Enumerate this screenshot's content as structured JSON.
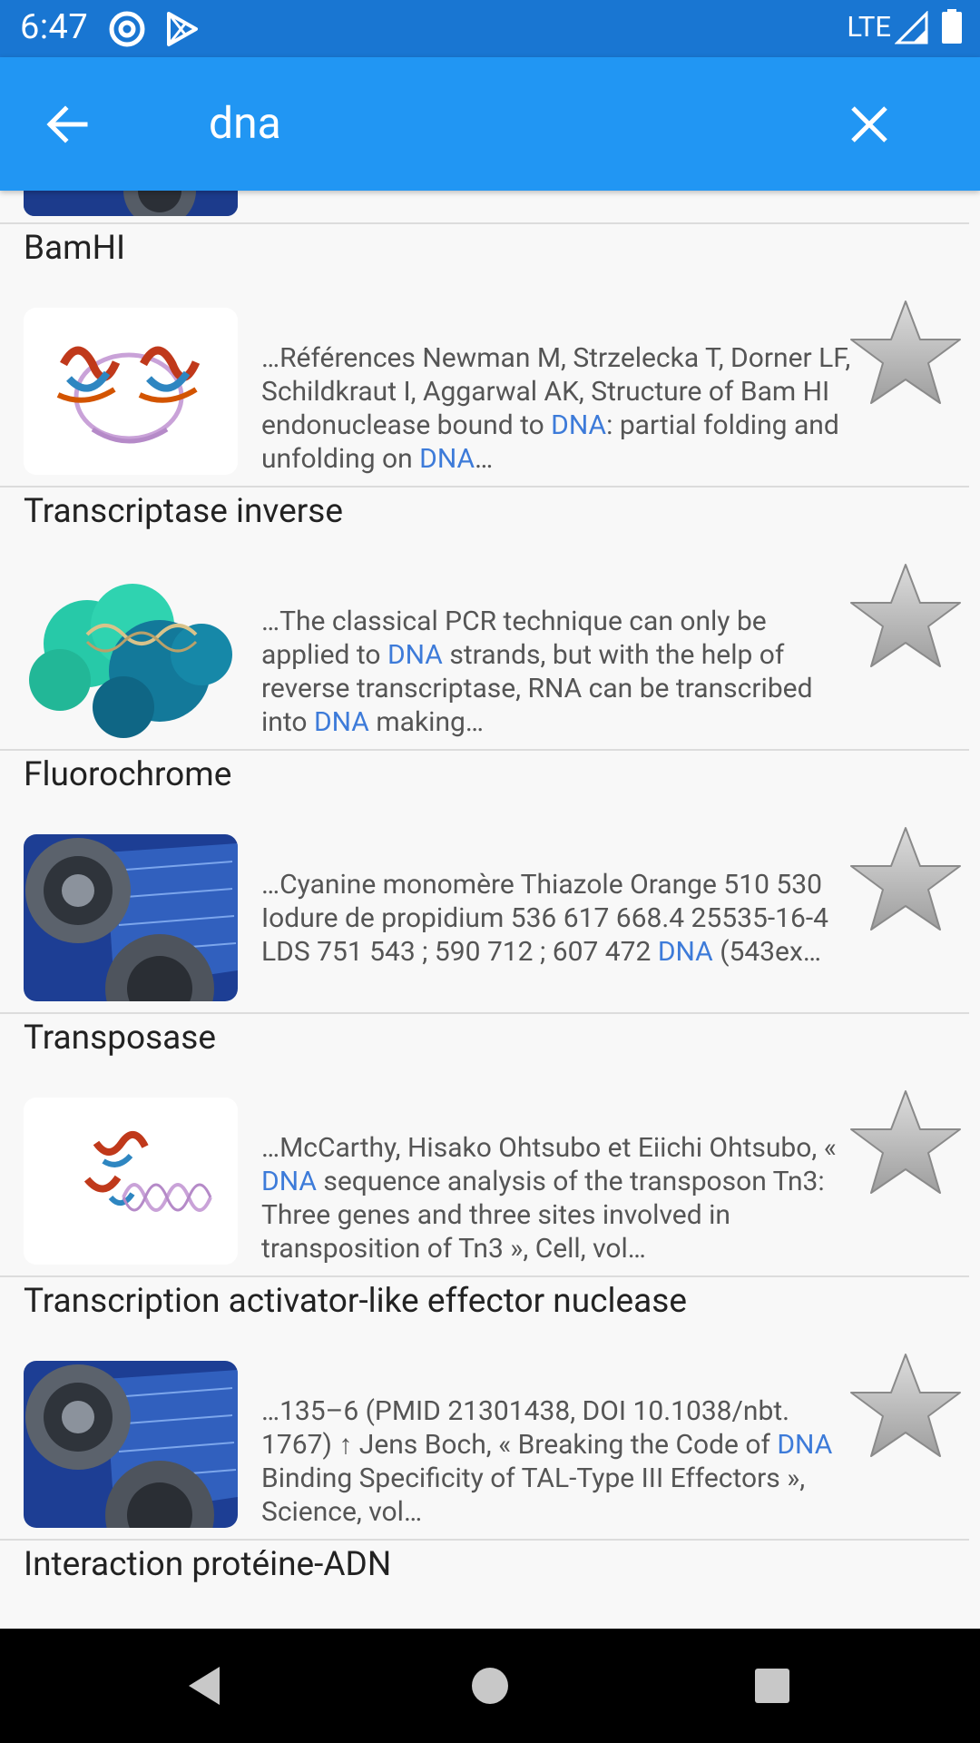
{
  "status_bar": {
    "time": "6:47",
    "network": "LTE"
  },
  "search": {
    "query": "dna"
  },
  "results": [
    {
      "title": "BamHI",
      "thumb": "protein-structure",
      "snippet": [
        {
          "t": "…Références Newman M, Strzelecka T, Dorner LF, Schildkraut I, Aggarwal AK, Structure of Bam HI endonuclease bound to "
        },
        {
          "t": "DNA",
          "hl": true
        },
        {
          "t": ": partial folding and unfolding on "
        },
        {
          "t": "DNA",
          "hl": true
        },
        {
          "t": "…"
        }
      ]
    },
    {
      "title": "Transcriptase inverse",
      "thumb": "molecule-surface",
      "snippet": [
        {
          "t": "…The classical PCR technique can only be applied to "
        },
        {
          "t": "DNA",
          "hl": true
        },
        {
          "t": " strands, but with the help of reverse transcriptase, RNA can be transcribed into "
        },
        {
          "t": "DNA",
          "hl": true
        },
        {
          "t": " making…"
        }
      ]
    },
    {
      "title": "Fluorochrome",
      "thumb": "gears-placeholder",
      "snippet": [
        {
          "t": "…Cyanine monomère Thiazole Orange 510 530 Iodure de propidium 536 617 668.4 25535-16-4 LDS 751 543 ; 590 712 ; 607 472 "
        },
        {
          "t": "DNA",
          "hl": true
        },
        {
          "t": " (543ex…"
        }
      ]
    },
    {
      "title": "Transposase",
      "thumb": "protein-dna-complex",
      "snippet": [
        {
          "t": "…McCarthy, Hisako Ohtsubo et Eiichi Ohtsubo, « "
        },
        {
          "t": "DNA",
          "hl": true
        },
        {
          "t": " sequence analysis of the transposon Tn3: Three genes and three sites involved in transposition of Tn3 », Cell, vol…"
        }
      ]
    },
    {
      "title": "Transcription activator-like effector nuclease",
      "thumb": "gears-placeholder",
      "snippet": [
        {
          "t": "…135–6 (PMID 21301438, DOI 10.1038/nbt. 1767) ↑ Jens Boch, « Breaking the Code of "
        },
        {
          "t": "DNA",
          "hl": true
        },
        {
          "t": " Binding Specificity of TAL-Type III Effectors », Science, vol…"
        }
      ]
    }
  ],
  "last_title": "Interaction protéine-ADN",
  "colors": {
    "appbar": "#2196f3",
    "statusbar": "#1976d2",
    "highlight": "#3d7bd9",
    "star": "#bdbdbd"
  },
  "icons": [
    "back-arrow-icon",
    "close-icon",
    "star-icon",
    "nav-back-icon",
    "nav-home-icon",
    "nav-recents-icon"
  ]
}
